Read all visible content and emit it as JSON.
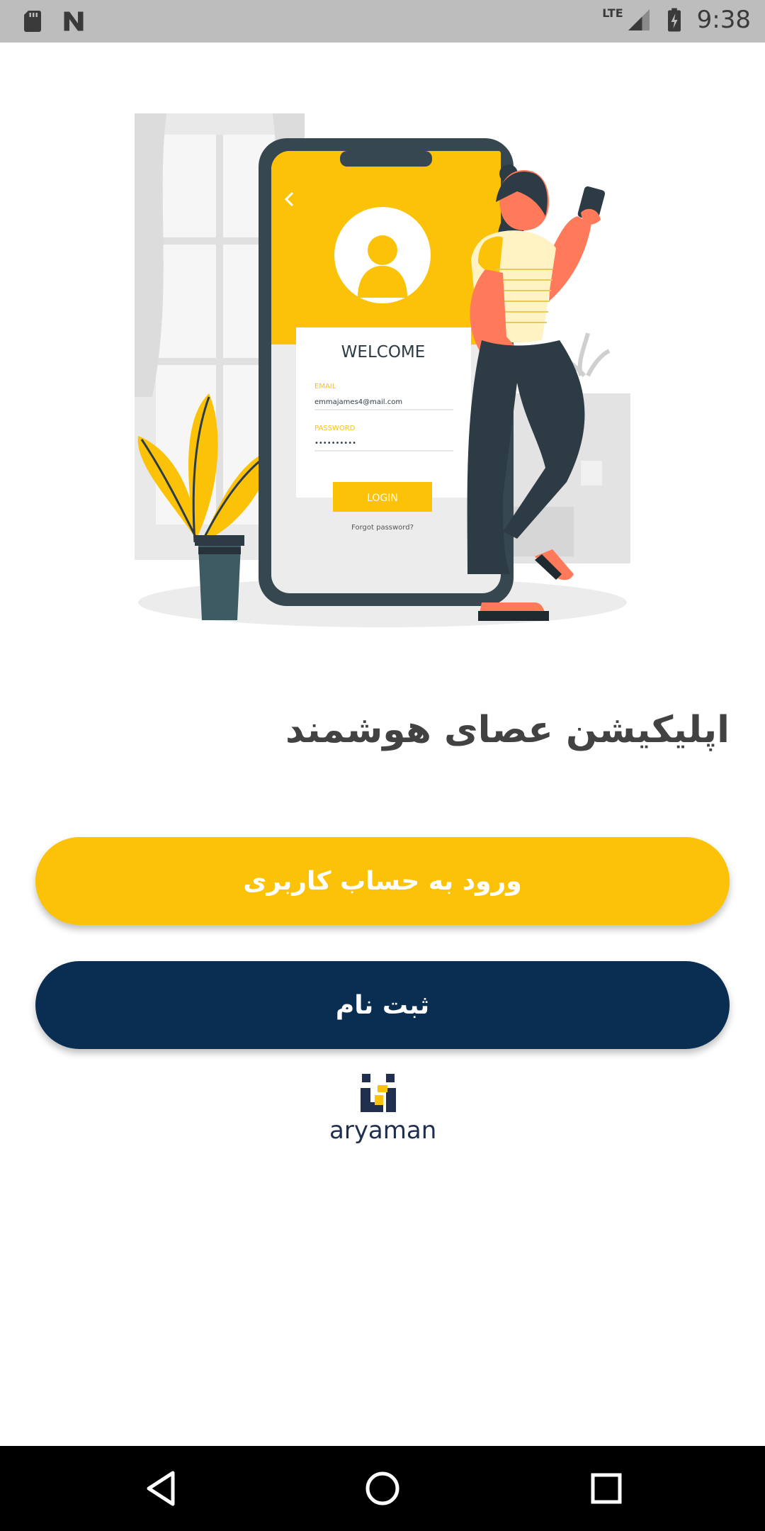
{
  "status_bar": {
    "time": "9:38",
    "network": "LTE",
    "icons": [
      "sd-card-icon",
      "n-notification-icon",
      "signal-icon",
      "battery-charging-icon"
    ]
  },
  "illustration": {
    "welcome_text": "WELCOME",
    "email_label": "EMAIL",
    "email_value": "emmajames4@mail.com",
    "password_label": "PASSWORD",
    "password_value": "••••••••••",
    "login_label": "LOGIN",
    "forgot_label": "Forgot password?"
  },
  "main": {
    "title": "اپلیکیشن عصای هوشمند",
    "login_button": "ورود به حساب کاربری",
    "register_button": "ثبت نام"
  },
  "logo": {
    "text": "aryaman"
  },
  "colors": {
    "accent_yellow": "#fbc207",
    "navy": "#0a2d52",
    "status_bar": "#bdbdbd",
    "nav_bar": "#000000"
  }
}
